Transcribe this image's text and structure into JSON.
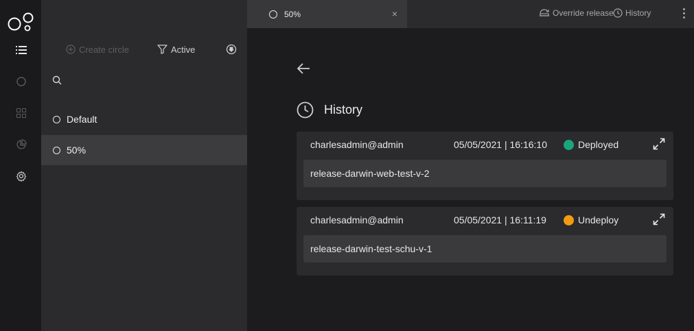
{
  "sidebar": {
    "items": [
      {
        "icon": "list-icon"
      },
      {
        "icon": "circle-icon"
      },
      {
        "icon": "grid-icon"
      },
      {
        "icon": "pie-chart-icon"
      },
      {
        "icon": "gear-icon"
      }
    ]
  },
  "panel": {
    "create_label": "Create circle",
    "filter_label": "Active",
    "circles": [
      {
        "name": "Default",
        "selected": false
      },
      {
        "name": "50%",
        "selected": true
      }
    ]
  },
  "tab": {
    "label": "50%",
    "close": "×"
  },
  "topbar": {
    "override_label": "Override release",
    "history_label": "History"
  },
  "history": {
    "title": "History",
    "entries": [
      {
        "author": "charlesadmin@admin",
        "datetime": "05/05/2021 | 16:16:10",
        "status": "Deployed",
        "status_color": "#1aa57c",
        "release": "release-darwin-web-test-v-2"
      },
      {
        "author": "charlesadmin@admin",
        "datetime": "05/05/2021 | 16:11:19",
        "status": "Undeploy",
        "status_color": "#f39c12",
        "release": "release-darwin-test-schu-v-1"
      }
    ]
  },
  "colors": {
    "accent_deployed": "#1aa57c",
    "accent_undeploy": "#f39c12",
    "background": "#1c1c1e"
  }
}
